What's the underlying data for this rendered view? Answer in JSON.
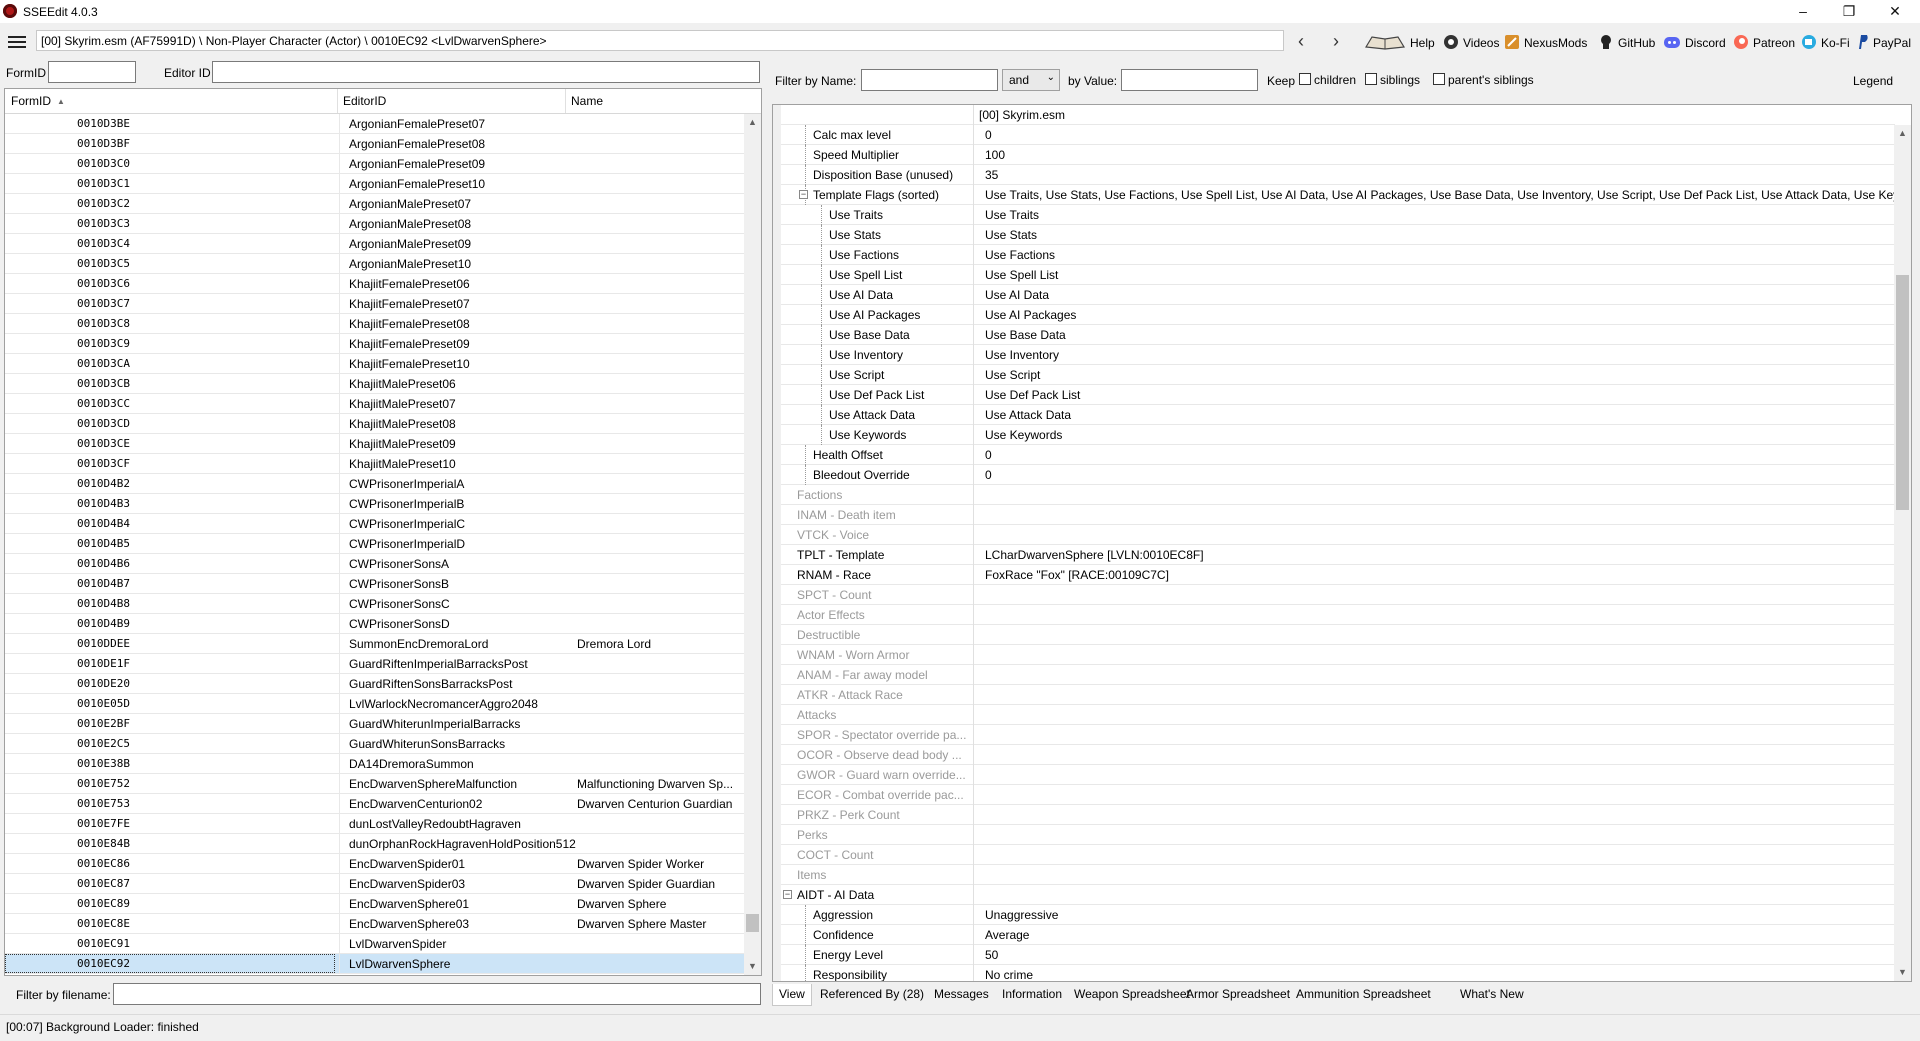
{
  "window": {
    "title": "SSEEdit 4.0.3",
    "minimize": "–",
    "maximize": "❐",
    "close": "✕"
  },
  "pathbar": {
    "path": "[00] Skyrim.esm (AF75991D) \\ Non-Player Character (Actor) \\ 0010EC92 <LvlDwarvenSphere>",
    "back": "‹",
    "forward": "›",
    "links": [
      {
        "label": "Help",
        "icon": "book-icon"
      },
      {
        "label": "Videos",
        "icon": "video-icon"
      },
      {
        "label": "NexusMods",
        "icon": "nexusmods-icon"
      },
      {
        "label": "GitHub",
        "icon": "github-icon"
      },
      {
        "label": "Discord",
        "icon": "discord-icon"
      },
      {
        "label": "Patreon",
        "icon": "patreon-icon"
      },
      {
        "label": "Ko-Fi",
        "icon": "kofi-icon"
      },
      {
        "label": "PayPal",
        "icon": "paypal-icon"
      }
    ]
  },
  "left": {
    "formid_label": "FormID",
    "formid_value": "",
    "editorid_label": "Editor ID",
    "editorid_value": "",
    "columns": [
      "FormID",
      "EditorID",
      "Name"
    ],
    "sort_indicator": "▲",
    "rows": [
      {
        "formid": "0010D3BE",
        "editorid": "ArgonianFemalePreset07",
        "name": ""
      },
      {
        "formid": "0010D3BF",
        "editorid": "ArgonianFemalePreset08",
        "name": ""
      },
      {
        "formid": "0010D3C0",
        "editorid": "ArgonianFemalePreset09",
        "name": ""
      },
      {
        "formid": "0010D3C1",
        "editorid": "ArgonianFemalePreset10",
        "name": ""
      },
      {
        "formid": "0010D3C2",
        "editorid": "ArgonianMalePreset07",
        "name": ""
      },
      {
        "formid": "0010D3C3",
        "editorid": "ArgonianMalePreset08",
        "name": ""
      },
      {
        "formid": "0010D3C4",
        "editorid": "ArgonianMalePreset09",
        "name": ""
      },
      {
        "formid": "0010D3C5",
        "editorid": "ArgonianMalePreset10",
        "name": ""
      },
      {
        "formid": "0010D3C6",
        "editorid": "KhajiitFemalePreset06",
        "name": ""
      },
      {
        "formid": "0010D3C7",
        "editorid": "KhajiitFemalePreset07",
        "name": ""
      },
      {
        "formid": "0010D3C8",
        "editorid": "KhajiitFemalePreset08",
        "name": ""
      },
      {
        "formid": "0010D3C9",
        "editorid": "KhajiitFemalePreset09",
        "name": ""
      },
      {
        "formid": "0010D3CA",
        "editorid": "KhajiitFemalePreset10",
        "name": ""
      },
      {
        "formid": "0010D3CB",
        "editorid": "KhajiitMalePreset06",
        "name": ""
      },
      {
        "formid": "0010D3CC",
        "editorid": "KhajiitMalePreset07",
        "name": ""
      },
      {
        "formid": "0010D3CD",
        "editorid": "KhajiitMalePreset08",
        "name": ""
      },
      {
        "formid": "0010D3CE",
        "editorid": "KhajiitMalePreset09",
        "name": ""
      },
      {
        "formid": "0010D3CF",
        "editorid": "KhajiitMalePreset10",
        "name": ""
      },
      {
        "formid": "0010D4B2",
        "editorid": "CWPrisonerImperialA",
        "name": ""
      },
      {
        "formid": "0010D4B3",
        "editorid": "CWPrisonerImperialB",
        "name": ""
      },
      {
        "formid": "0010D4B4",
        "editorid": "CWPrisonerImperialC",
        "name": ""
      },
      {
        "formid": "0010D4B5",
        "editorid": "CWPrisonerImperialD",
        "name": ""
      },
      {
        "formid": "0010D4B6",
        "editorid": "CWPrisonerSonsA",
        "name": ""
      },
      {
        "formid": "0010D4B7",
        "editorid": "CWPrisonerSonsB",
        "name": ""
      },
      {
        "formid": "0010D4B8",
        "editorid": "CWPrisonerSonsC",
        "name": ""
      },
      {
        "formid": "0010D4B9",
        "editorid": "CWPrisonerSonsD",
        "name": ""
      },
      {
        "formid": "0010DDEE",
        "editorid": "SummonEncDremoraLord",
        "name": "Dremora Lord"
      },
      {
        "formid": "0010DE1F",
        "editorid": "GuardRiftenImperialBarracksPost",
        "name": ""
      },
      {
        "formid": "0010DE20",
        "editorid": "GuardRiftenSonsBarracksPost",
        "name": ""
      },
      {
        "formid": "0010E05D",
        "editorid": "LvlWarlockNecromancerAggro2048",
        "name": ""
      },
      {
        "formid": "0010E2BF",
        "editorid": "GuardWhiterunImperialBarracks",
        "name": ""
      },
      {
        "formid": "0010E2C5",
        "editorid": "GuardWhiterunSonsBarracks",
        "name": ""
      },
      {
        "formid": "0010E38B",
        "editorid": "DA14DremoraSummon",
        "name": ""
      },
      {
        "formid": "0010E752",
        "editorid": "EncDwarvenSphereMalfunction",
        "name": "Malfunctioning Dwarven Sp..."
      },
      {
        "formid": "0010E753",
        "editorid": "EncDwarvenCenturion02",
        "name": "Dwarven Centurion Guardian"
      },
      {
        "formid": "0010E7FE",
        "editorid": "dunLostValleyRedoubtHagraven",
        "name": ""
      },
      {
        "formid": "0010E84B",
        "editorid": "dunOrphanRockHagravenHoldPosition512",
        "name": ""
      },
      {
        "formid": "0010EC86",
        "editorid": "EncDwarvenSpider01",
        "name": "Dwarven Spider Worker"
      },
      {
        "formid": "0010EC87",
        "editorid": "EncDwarvenSpider03",
        "name": "Dwarven Spider Guardian"
      },
      {
        "formid": "0010EC89",
        "editorid": "EncDwarvenSphere01",
        "name": "Dwarven Sphere"
      },
      {
        "formid": "0010EC8E",
        "editorid": "EncDwarvenSphere03",
        "name": "Dwarven Sphere Master"
      },
      {
        "formid": "0010EC91",
        "editorid": "LvlDwarvenSpider",
        "name": ""
      },
      {
        "formid": "0010EC92",
        "editorid": "LvlDwarvenSphere",
        "name": "",
        "selected": true
      }
    ],
    "filter_label": "Filter by filename:",
    "filter_value": ""
  },
  "right": {
    "filter_name_label": "Filter by Name:",
    "filter_name_value": "",
    "and_label": "and",
    "by_value_label": "by Value:",
    "by_value_value": "",
    "keep_label": "Keep",
    "children_label": "children",
    "siblings_label": "siblings",
    "parents_siblings_label": "parent's siblings",
    "legend_label": "Legend",
    "rows": [
      {
        "key": "",
        "value": "[00] Skyrim.esm",
        "indent": 0,
        "header": true
      },
      {
        "key": "Calc max level",
        "value": "0",
        "indent": 2
      },
      {
        "key": "Speed Multiplier",
        "value": "100",
        "indent": 2
      },
      {
        "key": "Disposition Base (unused)",
        "value": "35",
        "indent": 2
      },
      {
        "key": "Template Flags (sorted)",
        "value": "Use Traits, Use Stats, Use Factions, Use Spell List, Use AI Data, Use AI Packages, Use Base Data, Use Inventory, Use Script, Use Def Pack List, Use Attack Data, Use Keywords",
        "indent": 2,
        "toggle": "−"
      },
      {
        "key": "Use Traits",
        "value": "Use Traits",
        "indent": 3
      },
      {
        "key": "Use Stats",
        "value": "Use Stats",
        "indent": 3
      },
      {
        "key": "Use Factions",
        "value": "Use Factions",
        "indent": 3
      },
      {
        "key": "Use Spell List",
        "value": "Use Spell List",
        "indent": 3
      },
      {
        "key": "Use AI Data",
        "value": "Use AI Data",
        "indent": 3
      },
      {
        "key": "Use AI Packages",
        "value": "Use AI Packages",
        "indent": 3
      },
      {
        "key": "Use Base Data",
        "value": "Use Base Data",
        "indent": 3
      },
      {
        "key": "Use Inventory",
        "value": "Use Inventory",
        "indent": 3
      },
      {
        "key": "Use Script",
        "value": "Use Script",
        "indent": 3
      },
      {
        "key": "Use Def Pack List",
        "value": "Use Def Pack List",
        "indent": 3
      },
      {
        "key": "Use Attack Data",
        "value": "Use Attack Data",
        "indent": 3
      },
      {
        "key": "Use Keywords",
        "value": "Use Keywords",
        "indent": 3
      },
      {
        "key": "Health Offset",
        "value": "0",
        "indent": 2
      },
      {
        "key": "Bleedout Override",
        "value": "0",
        "indent": 2
      },
      {
        "key": "Factions",
        "value": "",
        "indent": 1,
        "gray": true
      },
      {
        "key": "INAM - Death item",
        "value": "",
        "indent": 1,
        "gray": true
      },
      {
        "key": "VTCK - Voice",
        "value": "",
        "indent": 1,
        "gray": true
      },
      {
        "key": "TPLT - Template",
        "value": "LCharDwarvenSphere [LVLN:0010EC8F]",
        "indent": 1
      },
      {
        "key": "RNAM - Race",
        "value": "FoxRace \"Fox\" [RACE:00109C7C]",
        "indent": 1
      },
      {
        "key": "SPCT - Count",
        "value": "",
        "indent": 1,
        "gray": true
      },
      {
        "key": "Actor Effects",
        "value": "",
        "indent": 1,
        "gray": true
      },
      {
        "key": "Destructible",
        "value": "",
        "indent": 1,
        "gray": true
      },
      {
        "key": "WNAM - Worn Armor",
        "value": "",
        "indent": 1,
        "gray": true
      },
      {
        "key": "ANAM - Far away model",
        "value": "",
        "indent": 1,
        "gray": true
      },
      {
        "key": "ATKR - Attack Race",
        "value": "",
        "indent": 1,
        "gray": true
      },
      {
        "key": "Attacks",
        "value": "",
        "indent": 1,
        "gray": true
      },
      {
        "key": "SPOR - Spectator override pa...",
        "value": "",
        "indent": 1,
        "gray": true
      },
      {
        "key": "OCOR - Observe dead body ...",
        "value": "",
        "indent": 1,
        "gray": true
      },
      {
        "key": "GWOR - Guard warn override...",
        "value": "",
        "indent": 1,
        "gray": true
      },
      {
        "key": "ECOR - Combat override pac...",
        "value": "",
        "indent": 1,
        "gray": true
      },
      {
        "key": "PRKZ - Perk Count",
        "value": "",
        "indent": 1,
        "gray": true
      },
      {
        "key": "Perks",
        "value": "",
        "indent": 1,
        "gray": true
      },
      {
        "key": "COCT - Count",
        "value": "",
        "indent": 1,
        "gray": true
      },
      {
        "key": "Items",
        "value": "",
        "indent": 1,
        "gray": true
      },
      {
        "key": "AIDT - AI Data",
        "value": "",
        "indent": 1,
        "toggle": "−"
      },
      {
        "key": "Aggression",
        "value": "Unaggressive",
        "indent": 2
      },
      {
        "key": "Confidence",
        "value": "Average",
        "indent": 2
      },
      {
        "key": "Energy Level",
        "value": "50",
        "indent": 2
      },
      {
        "key": "Responsibility",
        "value": "No crime",
        "indent": 2
      }
    ],
    "tabs": [
      "View",
      "Referenced By (28)",
      "Messages",
      "Information",
      "Weapon Spreadsheet",
      "Armor Spreadsheet",
      "Ammunition Spreadsheet",
      "What's New"
    ],
    "active_tab": "View"
  },
  "status": {
    "text": "[00:07] Background Loader: finished"
  },
  "colors": {
    "selection": "#cce4f7",
    "gray_text": "#9a9a9a",
    "scroll_thumb": "#c1c1c1"
  }
}
